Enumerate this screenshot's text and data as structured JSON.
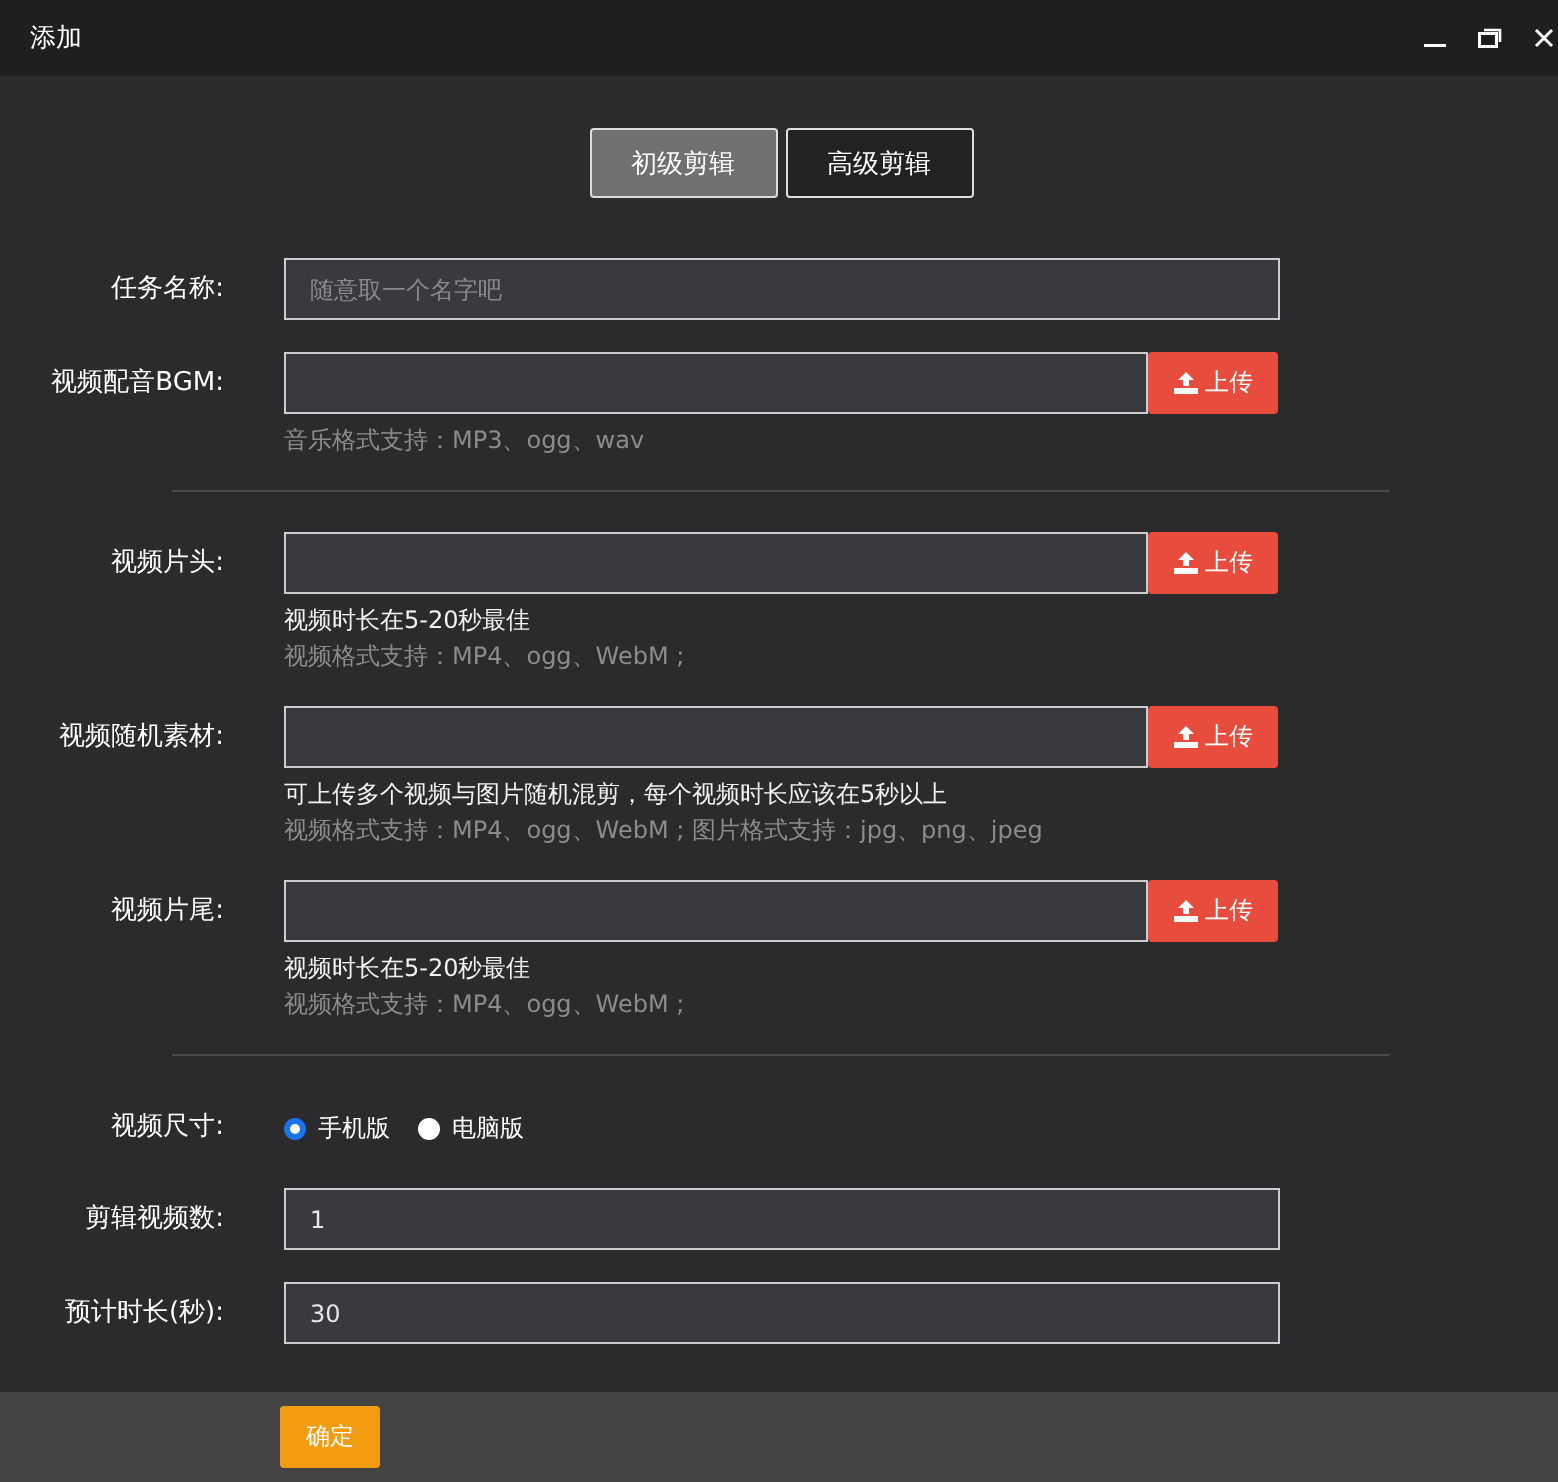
{
  "window": {
    "title": "添加"
  },
  "tabs": [
    {
      "label": "初级剪辑",
      "selected": true
    },
    {
      "label": "高级剪辑",
      "selected": false
    }
  ],
  "form": [
    {
      "kind": "text",
      "label": "任务名称:",
      "placeholder": "随意取一个名字吧"
    },
    {
      "kind": "upload",
      "label": "视频配音BGM:",
      "button": "上传",
      "notes": [
        {
          "kind": "format",
          "text": "音乐格式支持：MP3、ogg、wav"
        }
      ]
    },
    {
      "kind": "divider"
    },
    {
      "kind": "upload",
      "label": "视频片头:",
      "button": "上传",
      "notes": [
        {
          "kind": "tip",
          "text": "视频时长在5-20秒最佳"
        },
        {
          "kind": "format",
          "text": "视频格式支持：MP4、ogg、WebM ;"
        }
      ]
    },
    {
      "kind": "upload",
      "label": "视频随机素材:",
      "button": "上传",
      "notes": [
        {
          "kind": "tip",
          "text": "可上传多个视频与图片随机混剪，每个视频时长应该在5秒以上"
        },
        {
          "kind": "format",
          "text": "视频格式支持：MP4、ogg、WebM ; 图片格式支持：jpg、png、jpeg"
        }
      ]
    },
    {
      "kind": "upload",
      "label": "视频片尾:",
      "button": "上传",
      "notes": [
        {
          "kind": "tip",
          "text": "视频时长在5-20秒最佳"
        },
        {
          "kind": "format",
          "text": "视频格式支持：MP4、ogg、WebM ;"
        }
      ]
    },
    {
      "kind": "divider"
    },
    {
      "kind": "radio",
      "label": "视频尺寸:",
      "options": [
        {
          "label": "手机版",
          "selected": true
        },
        {
          "label": "电脑版",
          "selected": false
        }
      ]
    },
    {
      "kind": "text",
      "label": "剪辑视频数:",
      "value": "1"
    },
    {
      "kind": "text",
      "label": "预计时长(秒):",
      "value": "30"
    }
  ],
  "footer": {
    "button": "确定"
  }
}
